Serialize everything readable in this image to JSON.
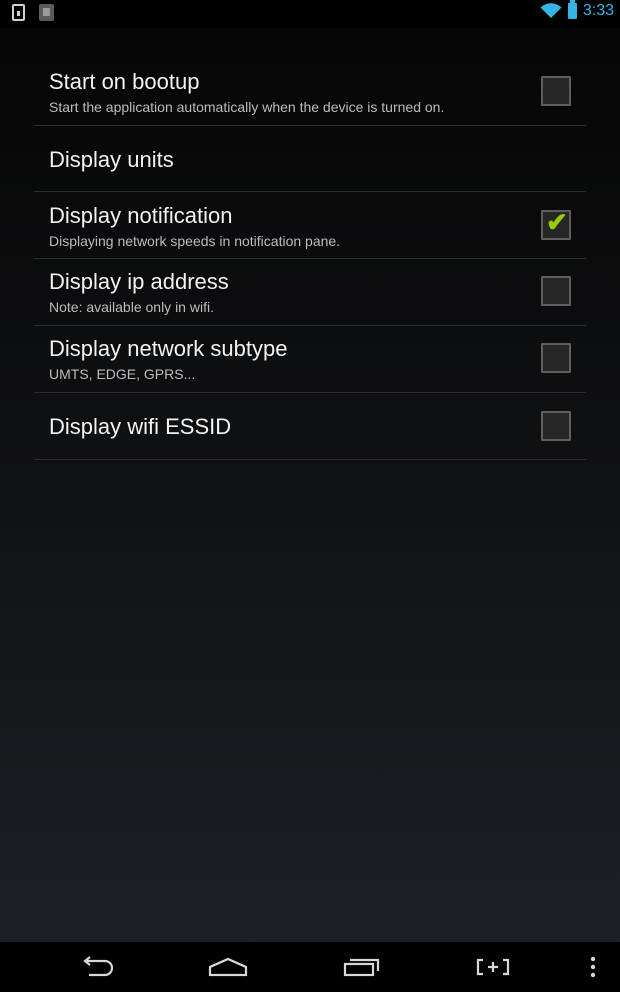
{
  "status_bar": {
    "time": "3:33",
    "icons": [
      "notification-icon",
      "download-icon",
      "wifi-icon",
      "battery-icon"
    ],
    "accent_color": "#33b5e5"
  },
  "preferences": [
    {
      "title": "Start on bootup",
      "summary": "Start the application automatically when the device is turned on.",
      "checkbox": true,
      "checked": false
    },
    {
      "title": "Display units",
      "summary": "",
      "checkbox": false
    },
    {
      "title": "Display notification",
      "summary": "Displaying network speeds in notification pane.",
      "checkbox": true,
      "checked": true
    },
    {
      "title": "Display ip address",
      "summary": "Note: available only in wifi.",
      "checkbox": true,
      "checked": false
    },
    {
      "title": "Display network subtype",
      "summary": "UMTS, EDGE, GPRS...",
      "checkbox": true,
      "checked": false
    },
    {
      "title": "Display wifi ESSID",
      "summary": "",
      "checkbox": true,
      "checked": false
    }
  ],
  "nav_bar": {
    "buttons": [
      "back-icon",
      "home-icon",
      "recents-icon",
      "screenshot-icon",
      "overflow-menu-icon"
    ]
  },
  "colors": {
    "check_color": "#99cc00",
    "divider": "#2c2e31"
  }
}
